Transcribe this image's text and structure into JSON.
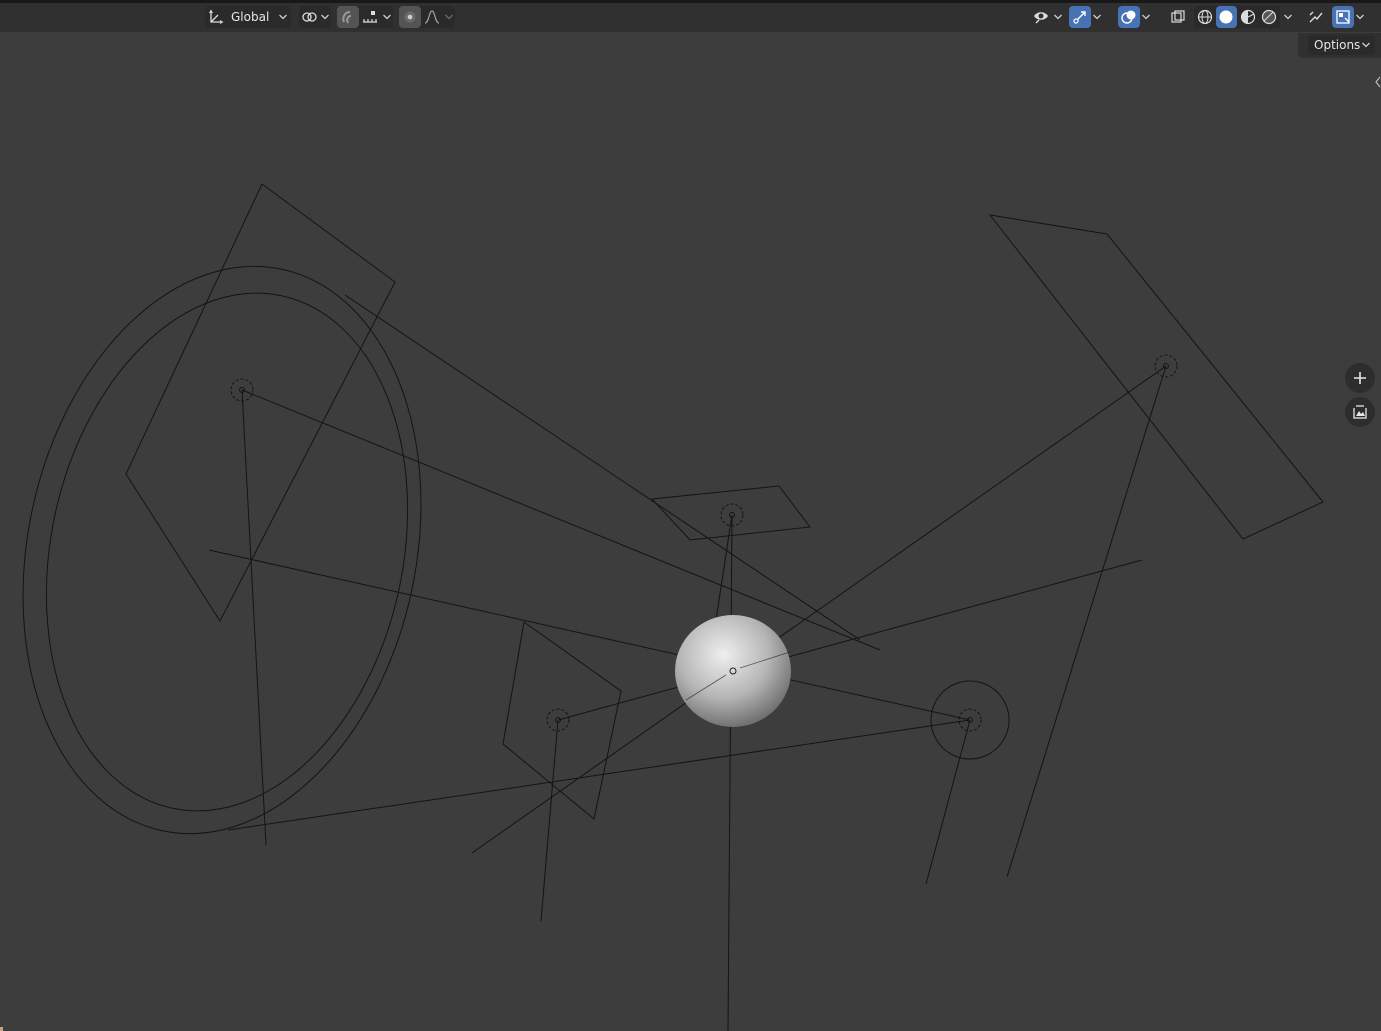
{
  "header": {
    "transform_orientation": {
      "label": "Global",
      "icon": "transform-orientation-icon"
    },
    "pivot_icon": "pivot-point-icon",
    "snap_icon": "snap-magnet-icon",
    "snap_target_icon": "snap-increment-icon",
    "proportional_icon": "proportional-editing-icon",
    "falloff_icon": "falloff-curve-icon",
    "visibility_icon": "eye-icon",
    "gizmo_icon": "gizmo-icon",
    "overlay_icon": "overlay-icon",
    "xray_icon": "xray-icon",
    "shading_modes": [
      "wireframe",
      "solid",
      "material-preview",
      "rendered"
    ],
    "active_shading": "solid",
    "extra_icons": [
      "sidebar-toggle-icon",
      "viewport-display-icon"
    ],
    "accent_color": "#4772b3"
  },
  "options": {
    "label": "Options"
  },
  "nav": {
    "zoom_icon": "plus-icon",
    "camera_icon": "camera-view-icon"
  },
  "viewport": {
    "background": "#3d3d3d",
    "wire_color": "#141414",
    "objects": [
      "large-circle-light",
      "square-area-light",
      "small-area-light",
      "spot-light",
      "point-light",
      "sun-light",
      "large-area-light",
      "sphere-mesh"
    ]
  }
}
